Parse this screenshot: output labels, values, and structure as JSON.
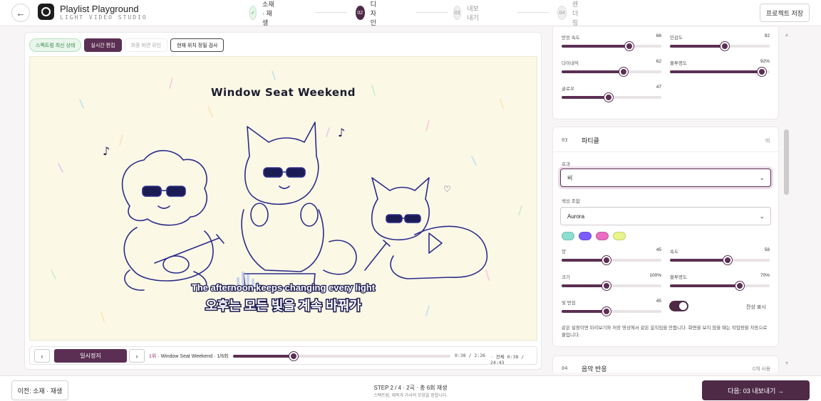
{
  "header": {
    "back_icon": "arrow-left-icon",
    "app_title": "Playlist Playground",
    "app_subtitle": "LIGHT VIDEO STUDIO",
    "save_label": "프로젝트 저장",
    "steps": [
      {
        "num": "✓",
        "label": "소재 · 재생",
        "state": "done"
      },
      {
        "num": "02",
        "label": "디자인",
        "state": "active"
      },
      {
        "num": "03",
        "label": "내보내기",
        "state": "todo"
      },
      {
        "num": "04",
        "label": "렌더링",
        "state": "todo"
      }
    ]
  },
  "editor": {
    "tabs": [
      "스펙트럼 최신 상태",
      "실시간 편집",
      "최종 화면 확인",
      "현재 위치 정밀 검사"
    ],
    "canvas": {
      "title": "Window Seat Weekend",
      "lyric_en": "The afternoon keeps changing every light",
      "lyric_ko": "오후는 모든 빛을 계속 바꿔가"
    },
    "player": {
      "prev_icon": "chevron-left-icon",
      "next_icon": "chevron-right-icon",
      "pause_label": "일시정지",
      "track_num": "1위",
      "track_title": " · Window Seat Weekend · 1/6회",
      "progress": 0.28,
      "time_current": "0:38 / 2:26",
      "time_total": "· 전체 0:38 / 24:43"
    }
  },
  "panel": {
    "top_sliders": [
      {
        "label": "반응 속도",
        "value": "68",
        "fill": 0.68
      },
      {
        "label": "민감도",
        "value": "92",
        "fill": 0.55
      },
      {
        "label": "다이내믹",
        "value": "62",
        "fill": 0.62
      },
      {
        "label": "불투명도",
        "value": "92%",
        "fill": 0.92
      },
      {
        "label": "글로우",
        "value": "47",
        "fill": 0.47
      }
    ],
    "particle": {
      "num": "03",
      "title": "파티클",
      "badge": "비",
      "effect_label": "효과",
      "effect_value": "비",
      "palette_label": "색상 조합",
      "palette_value": "Aurora",
      "swatches": [
        "#8be0cf",
        "#7c5bff",
        "#ea6fc1",
        "#e8f58a"
      ],
      "sliders": [
        {
          "label": "양",
          "value": "45",
          "fill": 0.45
        },
        {
          "label": "속도",
          "value": "58",
          "fill": 0.58
        },
        {
          "label": "크기",
          "value": "100%",
          "fill": 0.45
        },
        {
          "label": "불투명도",
          "value": "70%",
          "fill": 0.7
        },
        {
          "label": "빛 번짐",
          "value": "45",
          "fill": 0.45
        }
      ],
      "toggle_label": "잔상 표시",
      "description": "같은 설정이면 미리보기와 저장 영상에서 같은 움직임을 만듭니다. 화면을 보지 않을 때는 작업량을 자동으로 줄입니다."
    },
    "audio": {
      "num": "04",
      "title": "음악 반응",
      "badge": "0개 사용"
    }
  },
  "footer": {
    "prev_label": "이전: 소재 · 재생",
    "step_info": "STEP 2 / 4 · 2곡 · 총 6회 재생",
    "step_sub": "스펙트럼, 제목과 가사의 모양을 정합니다.",
    "next_label": "다음: 03 내보내기 →"
  }
}
